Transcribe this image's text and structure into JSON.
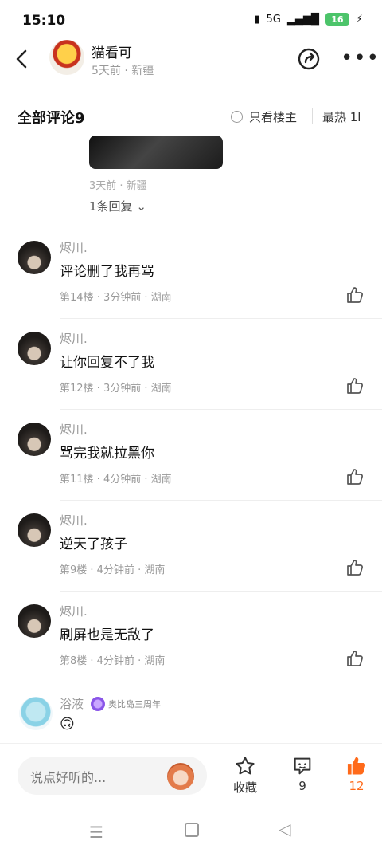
{
  "status_bar": {
    "time": "15:10",
    "network": "5G",
    "battery": "16"
  },
  "header": {
    "author": "猫看可",
    "author_meta": "5天前 · 新疆"
  },
  "comments_header": {
    "title": "全部评论9",
    "only_host": "只看楼主",
    "sort": "最热 1l"
  },
  "sub_reply": {
    "meta": "3天前 · 新疆",
    "reply_count": "1条回复"
  },
  "comments": [
    {
      "name": "烬川.",
      "text": "评论删了我再骂",
      "meta": "第14楼 · 3分钟前 · 湖南"
    },
    {
      "name": "烬川.",
      "text": "让你回复不了我",
      "meta": "第12楼 · 3分钟前 · 湖南"
    },
    {
      "name": "烬川.",
      "text": "骂完我就拉黑你",
      "meta": "第11楼 · 4分钟前 · 湖南"
    },
    {
      "name": "烬川.",
      "text": "逆天了孩子",
      "meta": "第9楼 · 4分钟前 · 湖南"
    },
    {
      "name": "烬川.",
      "text": "刷屏也是无敌了",
      "meta": "第8楼 · 4分钟前 · 湖南"
    }
  ],
  "last_comment": {
    "name": "浴液",
    "badge": "奥比岛三周年",
    "text": "🙃"
  },
  "bottom_bar": {
    "placeholder": "说点好听的...",
    "favorite_label": "收藏",
    "comment_count": "9",
    "like_count": "12"
  },
  "colors": {
    "accent": "#ff6a1a",
    "meta_gray": "#999999"
  }
}
